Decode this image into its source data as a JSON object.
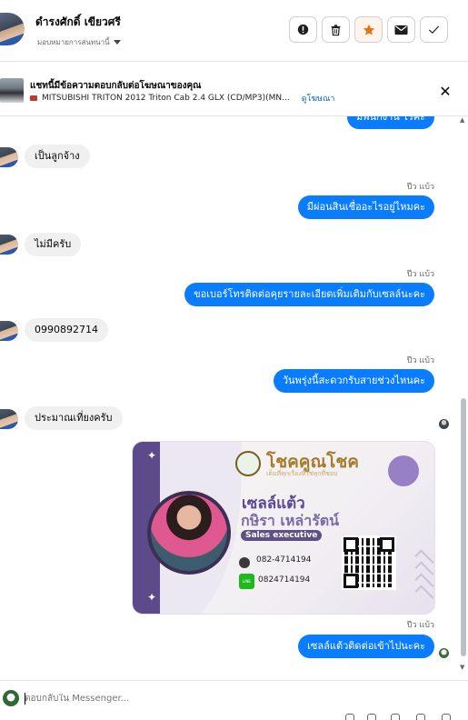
{
  "header": {
    "contact_name": "ดำรงศักดิ์ เขียวศรี",
    "assign_label": "มอบหมายการสนทนานี้",
    "buttons": [
      {
        "name": "report-button",
        "icon": "alert-circle-icon"
      },
      {
        "name": "delete-button",
        "icon": "trash-icon"
      },
      {
        "name": "star-button",
        "icon": "star-icon",
        "color": "#e4741b"
      },
      {
        "name": "mail-button",
        "icon": "envelope-icon"
      },
      {
        "name": "done-button",
        "icon": "check-icon"
      }
    ]
  },
  "ad_bar": {
    "title": "แชทนี้มีข้อความตอบกลับต่อโฆษณาของคุณ",
    "vehicle": "MITSUBISHI TRITON 2012 Triton Cab 2.4 GLX (CD/MP3)(MN...",
    "link": "ดูโฆษณา"
  },
  "messages": [
    {
      "dir": "out",
      "text": "มีพนักงาน ไรคะ",
      "partial": true
    },
    {
      "dir": "in",
      "text": "เป็นลูกจ้าง"
    },
    {
      "dir": "out",
      "time": "ปีว แบ้ว",
      "text": "มีผ่อนสินเชื่ออะไรอยู่ไหมคะ"
    },
    {
      "dir": "in",
      "text": "ไม่มีครับ"
    },
    {
      "dir": "out",
      "time": "ปีว แบ้ว",
      "text": "ขอเบอร์โทรติดต่อคุยรายละเอียดเพิ่มเติมกับเซลล์นะคะ"
    },
    {
      "dir": "in",
      "text": "0990892714"
    },
    {
      "dir": "out",
      "time": "ปีว แบ้ว",
      "text": "วันพรุ่งนี้สะดวกรับสายช่วงไหนคะ"
    },
    {
      "dir": "in",
      "text": "ประมาณเที่ยงครับ"
    },
    {
      "dir": "out",
      "type": "business-card"
    },
    {
      "dir": "out",
      "time": "ปีว แบ้ว",
      "text": "เซลล์แต้วติดต่อเข้าไปนะคะ"
    }
  ],
  "business_card": {
    "brand": "โชคคูณโชค",
    "tagline": "เต็มที่ทุกเรื่องที่ใช่ทุกที่ชอบ",
    "nickname": "เซลล์แต้ว",
    "full_name": "กษิรา เหล่ารัตน์",
    "role": "Sales executive",
    "phone": "082-4714194",
    "line_id": "0824714194",
    "line_badge": "LINE"
  },
  "composer": {
    "placeholder": "ตอบกลับใน Messenger..."
  },
  "colors": {
    "outgoing_bubble": "#0a7cff",
    "incoming_bubble": "#f0f0f0",
    "link": "#0064d1",
    "card_accent": "#5d4a8a"
  }
}
